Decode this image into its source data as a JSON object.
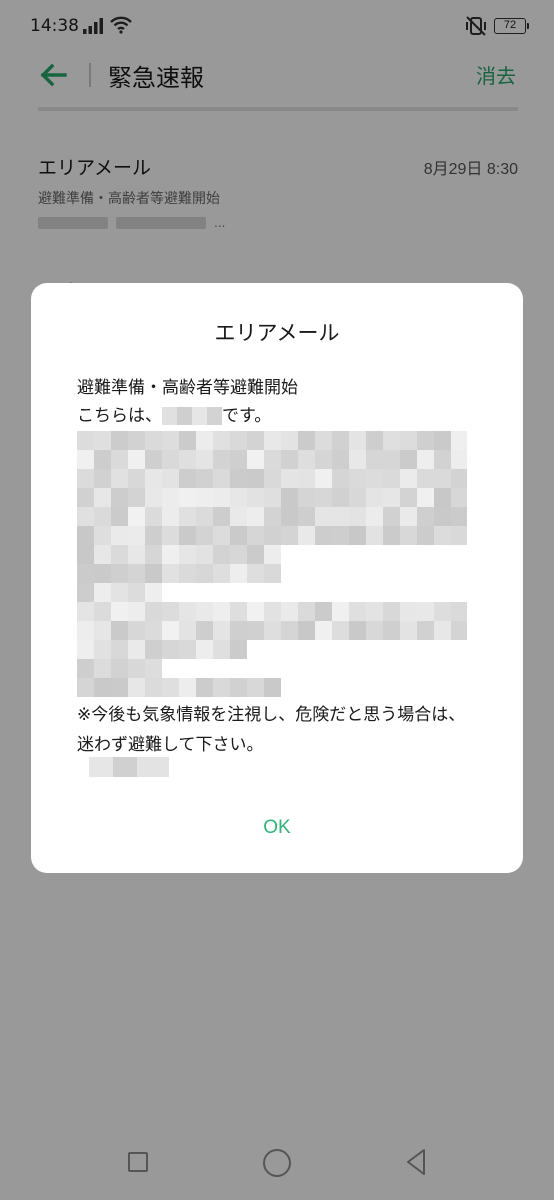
{
  "status_bar": {
    "time": "14:38",
    "battery_level": "72"
  },
  "header": {
    "title": "緊急速報",
    "clear_label": "消去"
  },
  "messages": [
    {
      "title": "エリアメール",
      "date": "8月29日 8:30",
      "subtitle": "避難準備・高齢者等避難開始",
      "ellipsis": "..."
    }
  ],
  "dialog": {
    "title": "エリアメール",
    "line1": "避難準備・高齢者等避難開始",
    "line2_prefix": "こちらは、",
    "line2_suffix": "です。",
    "note": "※今後も気象情報を注視し、危険だと思う場合は、迷わず避難して下さい。",
    "ok_label": "OK"
  },
  "colors": {
    "accent": "#26a86a",
    "ok": "#2ab777"
  },
  "icons": {
    "back": "arrow-left-icon",
    "nav_recent": "square-icon",
    "nav_home": "circle-icon",
    "nav_back": "triangle-back-icon"
  }
}
